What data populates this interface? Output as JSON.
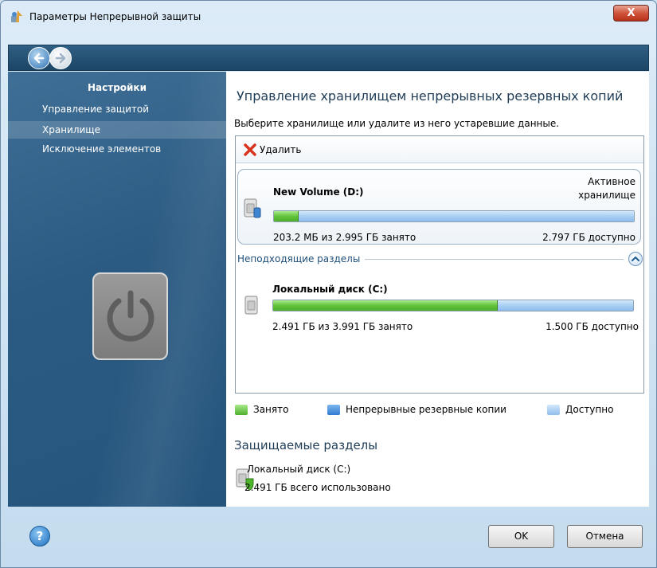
{
  "window": {
    "title": "Параметры Непрерывной защиты",
    "close_label": "X"
  },
  "sidebar": {
    "heading": "Настройки",
    "items": [
      {
        "label": "Управление защитой",
        "selected": false
      },
      {
        "label": "Хранилище",
        "selected": true
      },
      {
        "label": "Исключение элементов",
        "selected": false
      }
    ]
  },
  "main": {
    "heading": "Управление хранилищем непрерывных резервных копий",
    "subtitle": "Выберите хранилище или удалите из него устаревшие данные.",
    "toolbar": {
      "delete_label": "Удалить"
    },
    "active_volume": {
      "name": "New Volume (D:)",
      "status_line1": "Активное",
      "status_line2": "хранилище",
      "used_text": "203.2 МБ из 2.995 ГБ занято",
      "free_text": "2.797 ГБ доступно",
      "used_fraction": 0.068
    },
    "unsuitable_group": {
      "label": "Неподходящие разделы"
    },
    "local_volume": {
      "name": "Локальный диск (C:)",
      "used_text": "2.491 ГБ из 3.991 ГБ занято",
      "free_text": "1.500 ГБ доступно",
      "used_fraction": 0.624
    },
    "legend": [
      {
        "label": "Занято",
        "color": "#5cbf36"
      },
      {
        "label": "Непрерывные резервные копии",
        "color": "#3a86d8"
      },
      {
        "label": "Доступно",
        "color": "#a9cff2"
      }
    ],
    "protected": {
      "heading": "Защищаемые разделы",
      "volume_name": "Локальный диск (C:)",
      "used_text": "2.491 ГБ всего использовано"
    }
  },
  "footer": {
    "help_label": "?",
    "ok_label": "OK",
    "cancel_label": "Отмена"
  },
  "colors": {
    "sidebar_bg": "#2b5a82",
    "navbar_bg": "#1c4566",
    "heading_text": "#1f3c57",
    "used_green": "#5cbf36",
    "free_blue": "#a9cff2"
  }
}
